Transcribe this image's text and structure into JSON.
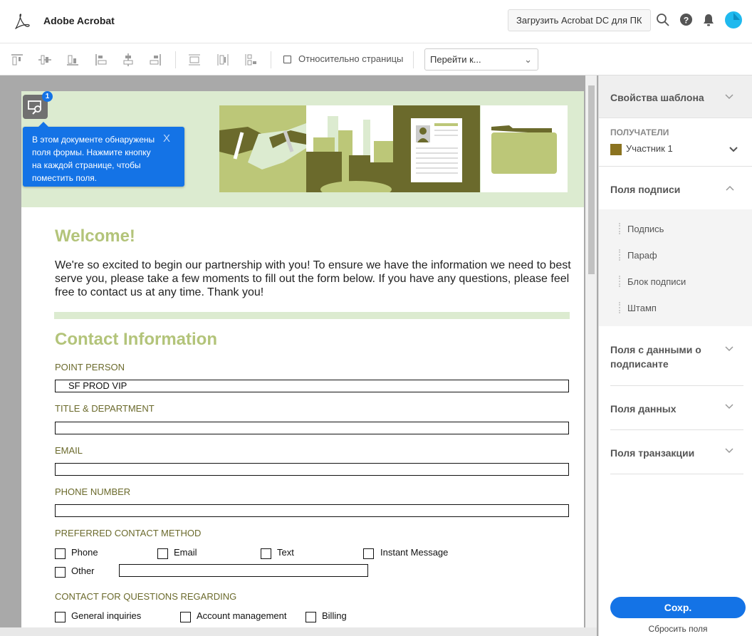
{
  "header": {
    "app_name": "Adobe Acrobat",
    "download_button": "Загрузить Acrobat DC для ПК",
    "icons": [
      "search-icon",
      "help-icon",
      "bell-icon",
      "avatar"
    ]
  },
  "toolbar": {
    "relative_to_page": "Относительно страницы",
    "relative_checked": false,
    "goto_placeholder": "Перейти к...",
    "goto_chevron": "⌄"
  },
  "tooltip": {
    "badge": "1",
    "text": "В этом документе обнаружены поля формы. Нажмите кнопку на каждой странице, чтобы поместить поля.",
    "close": "X"
  },
  "document": {
    "welcome": "Welcome!",
    "intro": "We're so excited to begin our partnership with you! To ensure we have the information we need to best serve you, please take a few moments to fill out the form below. If you have any questions, please feel free to contact us at any time. Thank you!",
    "section_title": "Contact Information",
    "fields": [
      {
        "label": "POINT PERSON",
        "value": "SF PROD VIP"
      },
      {
        "label": "TITLE & DEPARTMENT",
        "value": ""
      },
      {
        "label": "EMAIL",
        "value": ""
      },
      {
        "label": "PHONE NUMBER",
        "value": ""
      }
    ],
    "preferred_label": "PREFERRED CONTACT METHOD",
    "preferred_options": [
      "Phone",
      "Email",
      "Text",
      "Instant Message",
      "Other"
    ],
    "other_value": "",
    "questions_label": "CONTACT FOR QUESTIONS REGARDING",
    "questions_options": [
      "General inquiries",
      "Account management",
      "Billing"
    ]
  },
  "panel": {
    "template_props": "Свойства шаблона",
    "recipients_label": "ПОЛУЧАТЕЛИ",
    "recipient": "Участник 1",
    "recipient_color": "#8b7320",
    "signature_fields": "Поля подписи",
    "signature_items": [
      "Подпись",
      "Параф",
      "Блок подписи",
      "Штамп"
    ],
    "signer_fields": "Поля с данными о подписанте",
    "data_fields": "Поля данных",
    "transaction_fields": "Поля транзакции",
    "save": "Сохр.",
    "reset": "Сбросить поля"
  },
  "colors": {
    "accent": "#1473e6",
    "heading_green": "#b3c47a",
    "label_olive": "#6b6a2c",
    "banner_bg": "#dcebd0"
  }
}
